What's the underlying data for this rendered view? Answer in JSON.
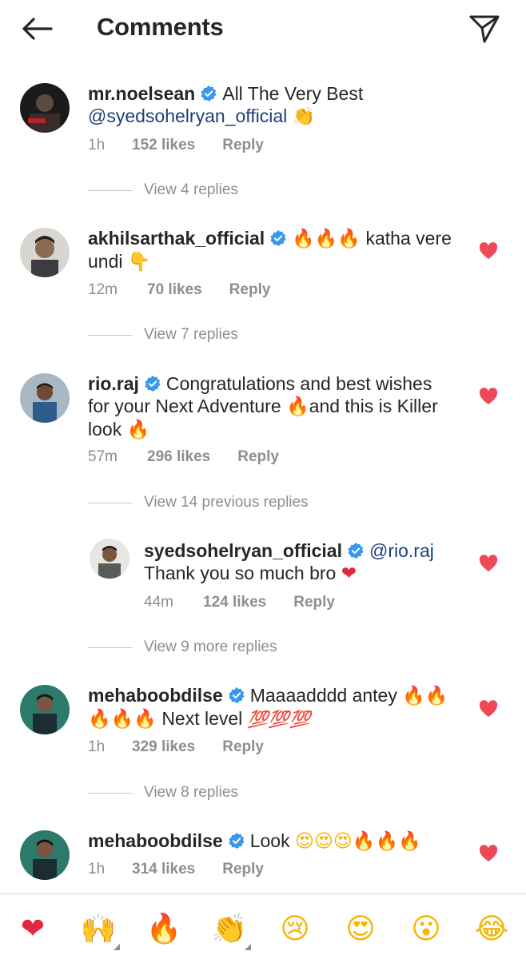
{
  "header": {
    "title": "Comments",
    "back_icon": "arrow-left-icon",
    "send_icon": "paper-plane-icon"
  },
  "colors": {
    "text": "#262626",
    "muted": "#8e8e8e",
    "mention": "#1e3f7a",
    "verified": "#3897f0",
    "like_heart": "#ed4956"
  },
  "comments": [
    {
      "username": "mr.noelsean",
      "text_before": "All The Very Best",
      "mention": "@syedsohelryan_official",
      "emoji_end": "👏",
      "time": "1h",
      "likes": "152 likes",
      "reply": "Reply",
      "view_replies": "View 4 replies"
    },
    {
      "username": "akhilsarthak_official",
      "emoji_start": "🔥🔥🔥",
      "text": "katha vere",
      "text_line2": "undi",
      "emoji_end": "👇",
      "time": "12m",
      "likes": "70 likes",
      "reply": "Reply",
      "view_replies": "View 7 replies"
    },
    {
      "username": "rio.raj",
      "text_line1": "Congratulations and best wishes",
      "text_line2a": "for your Next Adventure",
      "text_line2b": "and this is Killer",
      "text_line3": "look",
      "emoji": "🔥",
      "time": "57m",
      "likes": "296 likes",
      "reply": "Reply",
      "view_replies": "View 14 previous replies"
    },
    {
      "username": "syedsohelryan_official",
      "mention": "@rio.raj",
      "text": "Thank you so much bro",
      "emoji_end": "❤",
      "time": "44m",
      "likes": "124 likes",
      "reply": "Reply",
      "view_replies": "View 9 more replies"
    },
    {
      "username": "mehaboobdilse",
      "text": "Maaaadddd antey",
      "emoji_a": "🔥🔥",
      "emoji_b": "🔥🔥🔥",
      "text2": "Next level",
      "emoji_100": "💯💯💯",
      "time": "1h",
      "likes": "329 likes",
      "reply": "Reply",
      "view_replies": "View 8 replies"
    },
    {
      "username": "mehaboobdilse",
      "text": "Look",
      "emoji_eyes": "😍😍😍",
      "emoji_fire": "🔥🔥🔥",
      "time": "1h",
      "likes": "314 likes",
      "reply": "Reply"
    }
  ],
  "quick_reactions": [
    "❤",
    "🙌",
    "🔥",
    "👏",
    "😢",
    "😍",
    "😮",
    "😂"
  ]
}
